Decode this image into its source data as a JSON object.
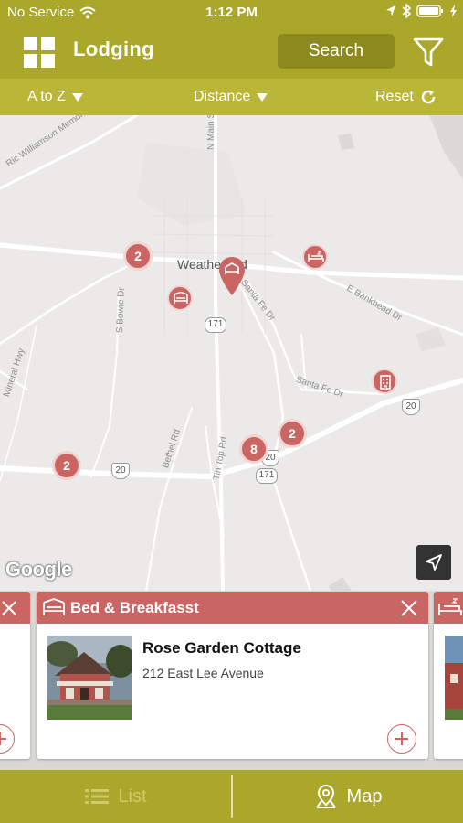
{
  "status_bar": {
    "carrier": "No Service",
    "time": "1:12 PM"
  },
  "header": {
    "title": "Lodging",
    "search_label": "Search",
    "menu_icon": "grid-icon",
    "filter_icon": "funnel-icon"
  },
  "sort_bar": {
    "alpha_label": "A to Z",
    "distance_label": "Distance",
    "reset_label": "Reset"
  },
  "map": {
    "city": "Weatherford",
    "road_labels": [
      "Ric Williamson Memorial Hwy",
      "N Main St",
      "S Bowie Dr",
      "Santa Fe Dr",
      "E Bankhead Dr",
      "Santa Fe Dr",
      "Bethel Rd",
      "Tin Top Rd",
      "Mineral Hwy"
    ],
    "highway_shields": [
      "171",
      "171",
      "20",
      "20",
      "20"
    ],
    "clusters": [
      "2",
      "2",
      "2",
      "8"
    ],
    "attribution": "Google",
    "locate_icon": "navigation-arrow-icon"
  },
  "card": {
    "category": "Bed & Breakfasst",
    "name": "Rose Garden Cottage",
    "address": "212 East Lee Avenue"
  },
  "tabs": {
    "list_label": "List",
    "map_label": "Map"
  },
  "colors": {
    "brand": "#aaa72a",
    "brand_dark": "#8c8a1f",
    "accent": "#c96664"
  }
}
